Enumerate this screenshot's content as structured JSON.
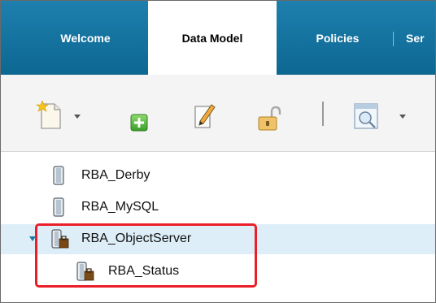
{
  "tabs": [
    {
      "label": "Welcome",
      "active": false
    },
    {
      "label": "Data Model",
      "active": true
    },
    {
      "label": "Policies",
      "active": false
    },
    {
      "label": "Ser",
      "active": false
    }
  ],
  "toolbar": {
    "buttons": [
      "new-document-icon",
      "add-icon",
      "edit-pencil-icon",
      "unlock-icon",
      "preview-icon"
    ]
  },
  "tree": {
    "items": [
      {
        "label": "RBA_Derby",
        "icon": "database-icon",
        "level": 0
      },
      {
        "label": "RBA_MySQL",
        "icon": "database-icon",
        "level": 0
      },
      {
        "label": "RBA_ObjectServer",
        "icon": "objectserver-icon",
        "level": 0,
        "expanded": true,
        "selected": true
      },
      {
        "label": "RBA_Status",
        "icon": "objectserver-icon",
        "level": 1
      }
    ]
  },
  "colors": {
    "tab_bar": "#1a78a7",
    "selection": "#ddeef8",
    "highlight": "#ea1e28"
  }
}
